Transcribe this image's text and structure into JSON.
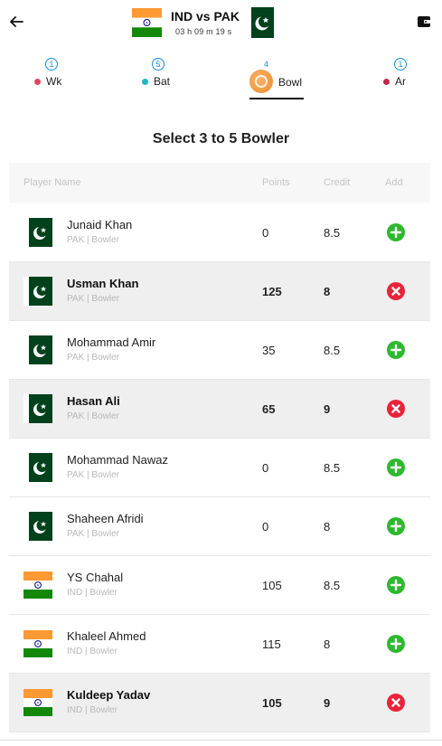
{
  "header": {
    "match_title": "IND vs PAK",
    "timer": "03 h 09 m 19 s",
    "icons": {
      "back": "back-arrow-icon",
      "wallet": "wallet-icon"
    }
  },
  "tabs": [
    {
      "id": "wk",
      "label": "Wk",
      "count": "1",
      "dot_color": "#e0465f",
      "active": false
    },
    {
      "id": "bat",
      "label": "Bat",
      "count": "5",
      "dot_color": "#1fb6c9",
      "active": false
    },
    {
      "id": "bowl",
      "label": "Bowl",
      "count": "4",
      "active": true
    },
    {
      "id": "ar",
      "label": "Ar",
      "count": "1",
      "dot_color": "#c2274a",
      "active": false
    }
  ],
  "section_title": "Select 3 to 5 Bowler",
  "table": {
    "headers": {
      "player": "Player Name",
      "points": "Points",
      "credit": "Credit",
      "add": "Add"
    },
    "rows": [
      {
        "name": "Junaid Khan",
        "meta": "PAK | Bowler",
        "team": "PAK",
        "points": "0",
        "credit": "8.5",
        "selected": false
      },
      {
        "name": "Usman Khan",
        "meta": "PAK | Bowler",
        "team": "PAK",
        "points": "125",
        "credit": "8",
        "selected": true
      },
      {
        "name": "Mohammad Amir",
        "meta": "PAK | Bowler",
        "team": "PAK",
        "points": "35",
        "credit": "8.5",
        "selected": false
      },
      {
        "name": "Hasan Ali",
        "meta": "PAK | Bowler",
        "team": "PAK",
        "points": "65",
        "credit": "9",
        "selected": true
      },
      {
        "name": "Mohammad Nawaz",
        "meta": "PAK | Bowler",
        "team": "PAK",
        "points": "0",
        "credit": "8.5",
        "selected": false
      },
      {
        "name": "Shaheen Afridi",
        "meta": "PAK | Bowler",
        "team": "PAK",
        "points": "0",
        "credit": "8",
        "selected": false
      },
      {
        "name": "YS Chahal",
        "meta": "IND | Bowler",
        "team": "IND",
        "points": "105",
        "credit": "8.5",
        "selected": false
      },
      {
        "name": "Khaleel Ahmed",
        "meta": "IND | Bowler",
        "team": "IND",
        "points": "115",
        "credit": "8",
        "selected": false
      },
      {
        "name": "Kuldeep Yadav",
        "meta": "IND | Bowler",
        "team": "IND",
        "points": "105",
        "credit": "9",
        "selected": true
      }
    ]
  },
  "colors": {
    "accent_blue": "#1a8fd6",
    "add_green": "#2fb82f",
    "remove_red": "#e8243a",
    "selected_row_bg": "#efefef",
    "pak_green": "#01411c",
    "ind_saffron": "#ff9933",
    "ind_green": "#138808",
    "ind_chakra": "#000080"
  }
}
